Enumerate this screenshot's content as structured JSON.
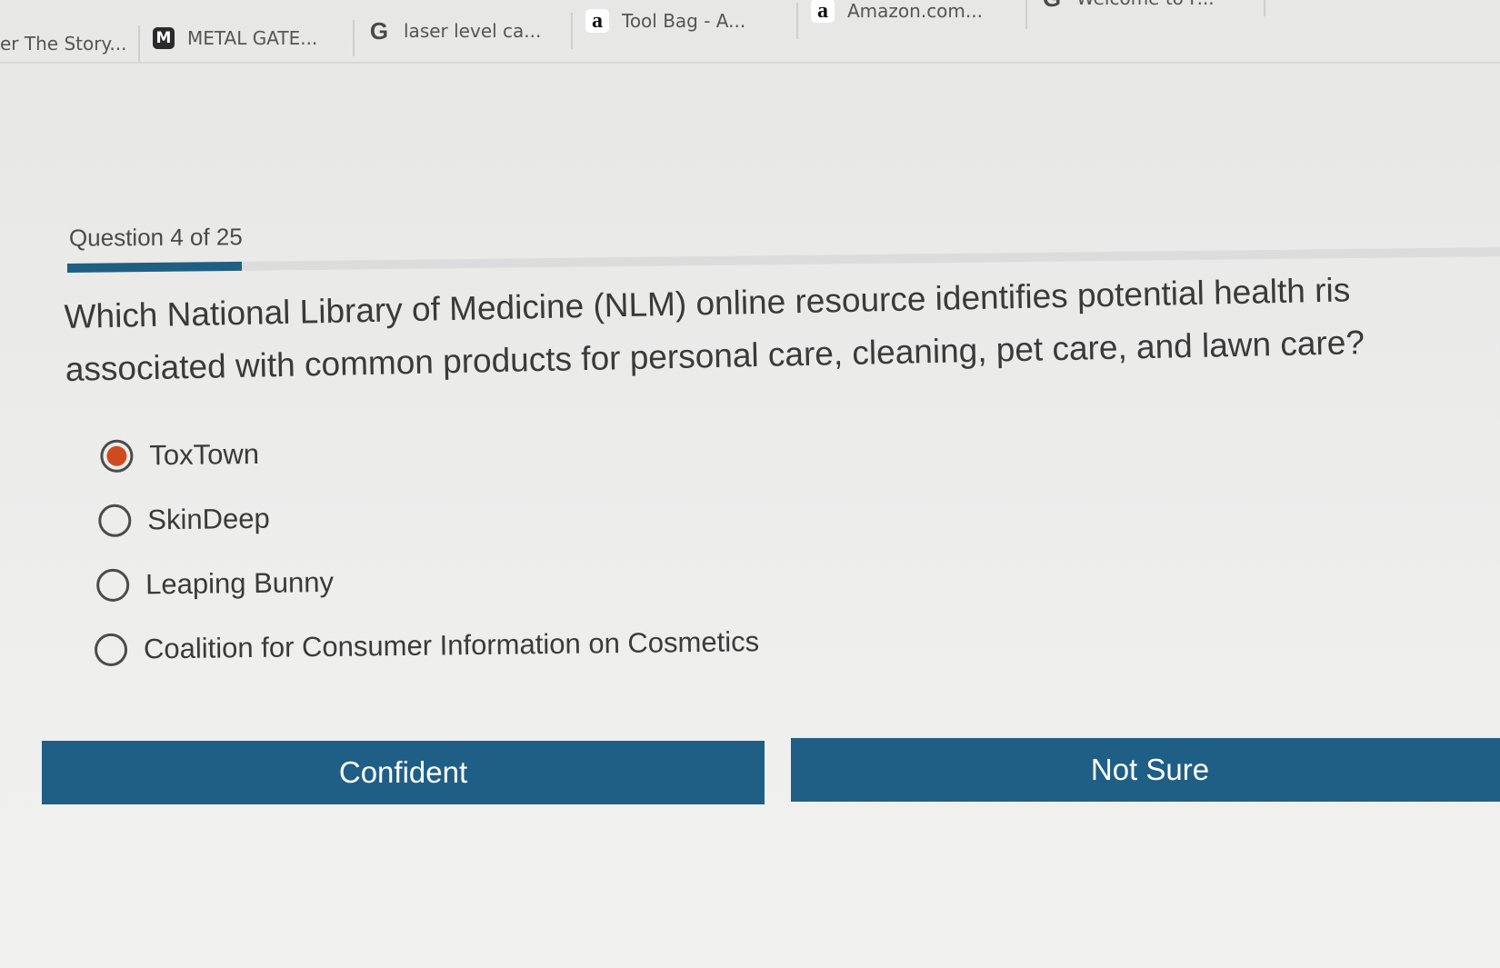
{
  "browser": {
    "tabs": [
      {
        "label": "er The Story...",
        "icon": ""
      },
      {
        "label": "METAL GATE...",
        "icon": "M"
      },
      {
        "label": "laser level ca...",
        "icon": "G"
      },
      {
        "label": "Tool Bag - A...",
        "icon": "a"
      },
      {
        "label": "Amazon.com...",
        "icon": "a"
      },
      {
        "label": "Welcome to F...",
        "icon": "G"
      }
    ]
  },
  "quiz": {
    "counter": "Question 4 of 25",
    "progress": 0.16,
    "question": "Which National Library of Medicine (NLM) online resource identifies potential health risks associated with common products for personal care, cleaning, pet care, and lawn care?",
    "question_line1": "Which National Library of Medicine (NLM) online resource identifies potential health ris",
    "question_line2": "associated with common products for personal care, cleaning, pet care, and lawn care?",
    "options": [
      {
        "label": "ToxTown",
        "selected": true
      },
      {
        "label": "SkinDeep",
        "selected": false
      },
      {
        "label": "Leaping Bunny",
        "selected": false
      },
      {
        "label": "Coalition for Consumer Information on Cosmetics",
        "selected": false
      }
    ],
    "buttons": {
      "confident": "Confident",
      "not_sure": "Not Sure"
    }
  },
  "colors": {
    "accent": "#1f5f86",
    "selected_radio": "#cf4b1f",
    "background": "#ebebea"
  }
}
